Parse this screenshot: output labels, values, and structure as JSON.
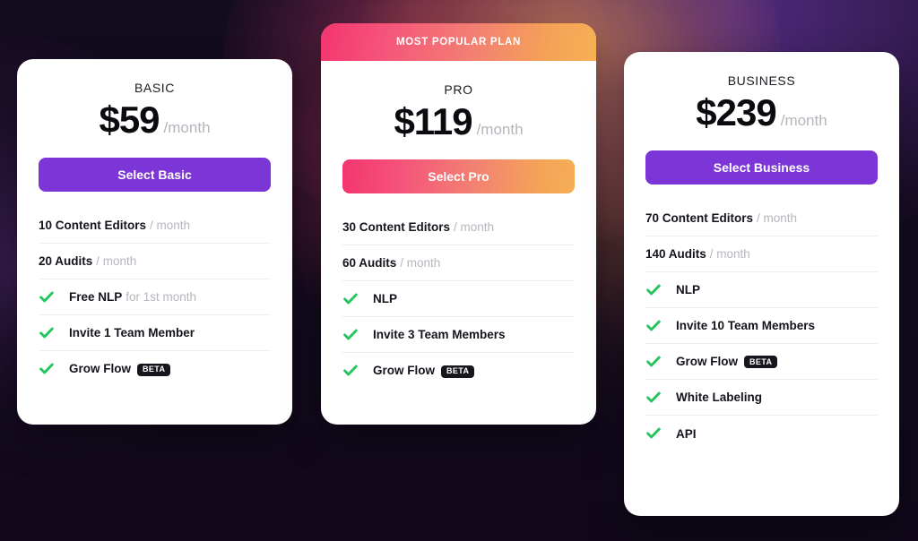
{
  "theme": {
    "background_dark": "#130b1e",
    "glow_purple": "#562c84",
    "glow_magenta": "#e24878",
    "glow_orange": "#f6a054",
    "accent_purple": "#7c35d6",
    "gradient_start": "#f4356f",
    "gradient_end": "#f6ae55",
    "check_green": "#22c55e",
    "badge_dark": "#16161d",
    "muted_text": "#b6b6bf"
  },
  "plans": [
    {
      "id": "basic",
      "name": "BASIC",
      "price": "$59",
      "period": "/month",
      "button_label": "Select Basic",
      "button_style": "purple",
      "banner": null,
      "features": [
        {
          "check": false,
          "strong": "10 Content Editors",
          "muted": "/ month",
          "badge": null
        },
        {
          "check": false,
          "strong": "20 Audits",
          "muted": "/ month",
          "badge": null
        },
        {
          "check": true,
          "strong": "Free NLP",
          "muted": "for 1st month",
          "badge": null
        },
        {
          "check": true,
          "strong": "Invite 1 Team Member",
          "muted": "",
          "badge": null
        },
        {
          "check": true,
          "strong": "Grow Flow",
          "muted": "",
          "badge": "BETA"
        }
      ]
    },
    {
      "id": "pro",
      "name": "PRO",
      "price": "$119",
      "period": "/month",
      "button_label": "Select Pro",
      "button_style": "gradient",
      "banner": "MOST POPULAR PLAN",
      "features": [
        {
          "check": false,
          "strong": "30 Content Editors",
          "muted": "/ month",
          "badge": null
        },
        {
          "check": false,
          "strong": "60 Audits",
          "muted": "/ month",
          "badge": null
        },
        {
          "check": true,
          "strong": "NLP",
          "muted": "",
          "badge": null
        },
        {
          "check": true,
          "strong": "Invite 3 Team Members",
          "muted": "",
          "badge": null
        },
        {
          "check": true,
          "strong": "Grow Flow",
          "muted": "",
          "badge": "BETA"
        }
      ]
    },
    {
      "id": "business",
      "name": "BUSINESS",
      "price": "$239",
      "period": "/month",
      "button_label": "Select Business",
      "button_style": "purple",
      "banner": null,
      "features": [
        {
          "check": false,
          "strong": "70 Content Editors",
          "muted": "/ month",
          "badge": null
        },
        {
          "check": false,
          "strong": "140 Audits",
          "muted": "/ month",
          "badge": null
        },
        {
          "check": true,
          "strong": "NLP",
          "muted": "",
          "badge": null
        },
        {
          "check": true,
          "strong": "Invite 10 Team Members",
          "muted": "",
          "badge": null
        },
        {
          "check": true,
          "strong": "Grow Flow",
          "muted": "",
          "badge": "BETA"
        },
        {
          "check": true,
          "strong": "White Labeling",
          "muted": "",
          "badge": null
        },
        {
          "check": true,
          "strong": "API",
          "muted": "",
          "badge": null
        }
      ]
    }
  ]
}
